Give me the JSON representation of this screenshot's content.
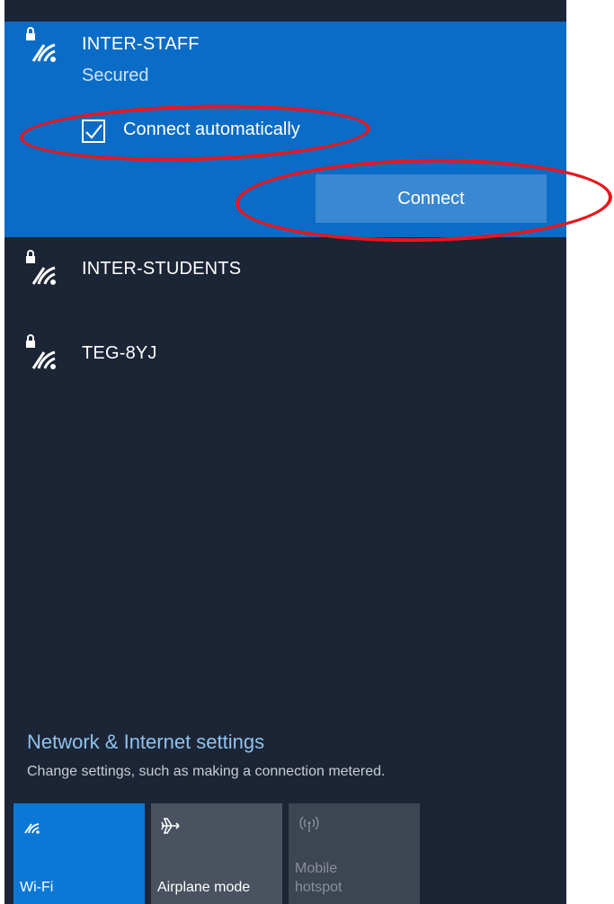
{
  "networks": {
    "selected": {
      "name": "INTER-STAFF",
      "status": "Secured",
      "auto_connect_label": "Connect automatically",
      "auto_connect_checked": true,
      "connect_label": "Connect"
    },
    "others": [
      {
        "name": "INTER-STUDENTS"
      },
      {
        "name": "TEG-8YJ"
      }
    ]
  },
  "settings": {
    "title": "Network & Internet settings",
    "subtitle": "Change settings, such as making a connection metered."
  },
  "quick_actions": {
    "wifi_label": "Wi-Fi",
    "airplane_label": "Airplane mode",
    "hotspot_label_line1": "Mobile",
    "hotspot_label_line2": "hotspot"
  },
  "icons": {
    "network": "wifi-secured-icon",
    "wifi": "wifi-icon",
    "airplane": "airplane-icon",
    "hotspot": "mobile-hotspot-icon",
    "check": "checkmark-icon"
  },
  "colors": {
    "panel_bg": "#1c2535",
    "selected_bg": "#0a6cc6",
    "connect_button": "#3a87d2",
    "wifi_tile_active": "#0b78d6",
    "tile_inactive": "#4a5260",
    "tile_disabled": "#3d4552",
    "link": "#8fc2ee",
    "annotation": "#e8161c"
  }
}
